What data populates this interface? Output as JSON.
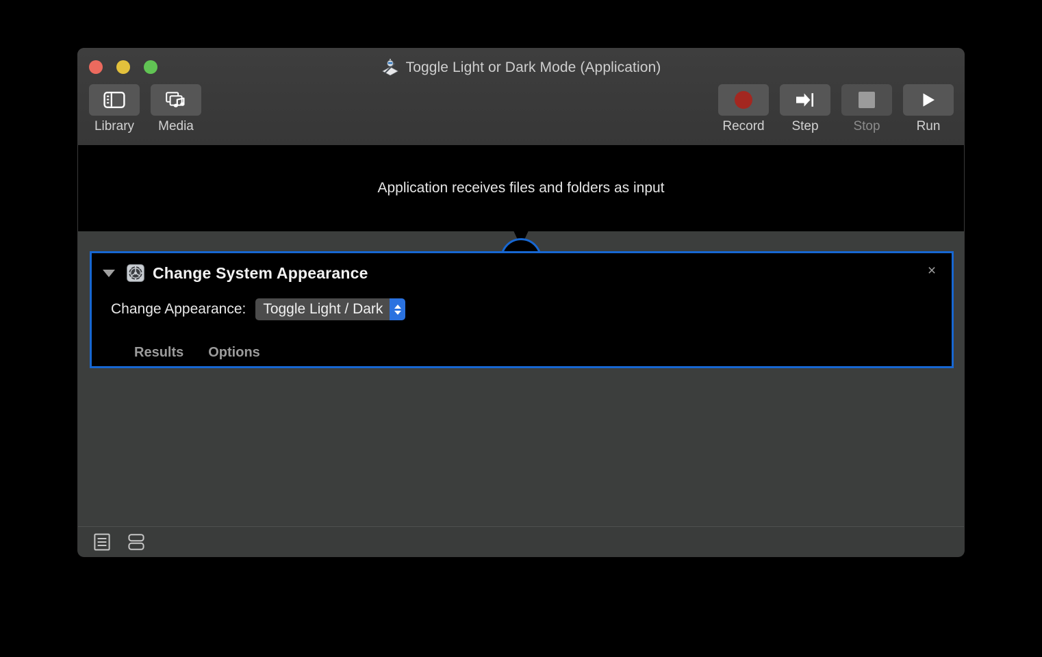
{
  "window": {
    "title": "Toggle Light or Dark Mode (Application)",
    "app_icon": "automator-robot-icon",
    "traffic_lights": {
      "close": "close-window-button",
      "minimize": "minimize-window-button",
      "zoom": "zoom-window-button"
    },
    "colors": {
      "titlebar": "#3a3a3a",
      "canvas": "#3c3e3d",
      "pane": "#000000",
      "selection_blue": "#1767d2",
      "popup_blue": "#2a72e0",
      "record_red": "#a32720",
      "traffic_red": "#ec6a5e",
      "traffic_yellow": "#e3c13c",
      "traffic_green": "#61c454"
    }
  },
  "toolbar": {
    "left_items": [
      {
        "label": "Library",
        "icon": "library-sidebar-icon",
        "enabled": true
      },
      {
        "label": "Media",
        "icon": "media-photo-music-icon",
        "enabled": true
      }
    ],
    "right_items": [
      {
        "label": "Record",
        "icon": "record-circle-icon",
        "enabled": true
      },
      {
        "label": "Step",
        "icon": "step-arrow-icon",
        "enabled": true
      },
      {
        "label": "Stop",
        "icon": "stop-square-icon",
        "enabled": false
      },
      {
        "label": "Run",
        "icon": "run-play-icon",
        "enabled": true
      }
    ]
  },
  "input_pane": {
    "text": "Application receives files and folders as input"
  },
  "action": {
    "title": "Change System Appearance",
    "icon": "system-preferences-gear-icon",
    "disclosure_state": "expanded",
    "close_label": "×",
    "field": {
      "label": "Change Appearance:",
      "value": "Toggle Light / Dark",
      "options": [
        "Toggle Light / Dark"
      ]
    },
    "tabs": [
      {
        "label": "Results"
      },
      {
        "label": "Options"
      }
    ]
  },
  "statusbar": {
    "icons": [
      {
        "name": "list-view-icon"
      },
      {
        "name": "grid-view-icon"
      }
    ]
  }
}
